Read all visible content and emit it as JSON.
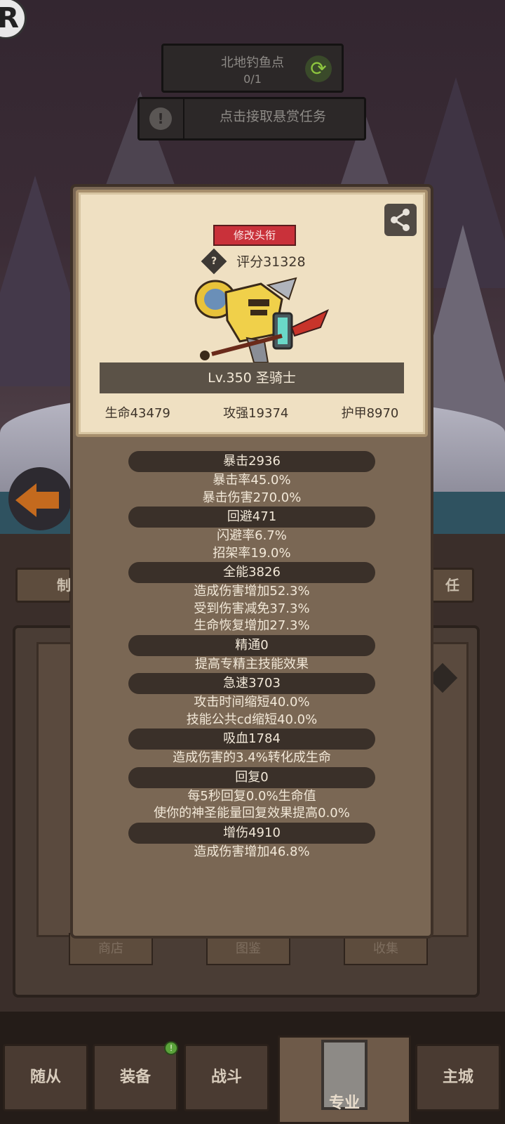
{
  "quest": {
    "location": "北地钓鱼点",
    "progress": "0/1",
    "bounty_label": "点击接取悬赏任务"
  },
  "side_tabs": {
    "left": "制",
    "right": "任"
  },
  "profile": {
    "edit_title_label": "修改头衔",
    "score_label": "评分31328",
    "level_class": "Lv.350 圣骑士",
    "stats": {
      "hp": "生命43479",
      "attack": "攻强19374",
      "armor": "护甲8970"
    }
  },
  "attributes": [
    {
      "header": "暴击2936",
      "lines": [
        "暴击率45.0%",
        "暴击伤害270.0%"
      ]
    },
    {
      "header": "回避471",
      "lines": [
        "闪避率6.7%",
        "招架率19.0%"
      ]
    },
    {
      "header": "全能3826",
      "lines": [
        "造成伤害增加52.3%",
        "受到伤害减免37.3%",
        "生命恢复增加27.3%"
      ]
    },
    {
      "header": "精通0",
      "lines": [
        "提高专精主技能效果"
      ]
    },
    {
      "header": "急速3703",
      "lines": [
        "攻击时间缩短40.0%",
        "技能公共cd缩短40.0%"
      ]
    },
    {
      "header": "吸血1784",
      "lines": [
        "造成伤害的3.4%转化成生命"
      ]
    },
    {
      "header": "回复0",
      "lines": [
        "每5秒回复0.0%生命值",
        "使你的神圣能量回复效果提高0.0%"
      ]
    },
    {
      "header": "增伤4910",
      "lines": [
        "造成伤害增加46.8%"
      ]
    }
  ],
  "lower_buttons": {
    "shop": "商店",
    "codex": "图鉴",
    "collect": "收集"
  },
  "nav": {
    "followers": "随从",
    "equipment": "装备",
    "battle": "战斗",
    "profession": "专业",
    "main_city": "主城",
    "equipment_badge": "!"
  },
  "colors": {
    "title_button": "#c9313a",
    "card_bg": "#efe0c2",
    "modal_bg": "#7a6754",
    "refresh_icon": "#8ec63f"
  }
}
